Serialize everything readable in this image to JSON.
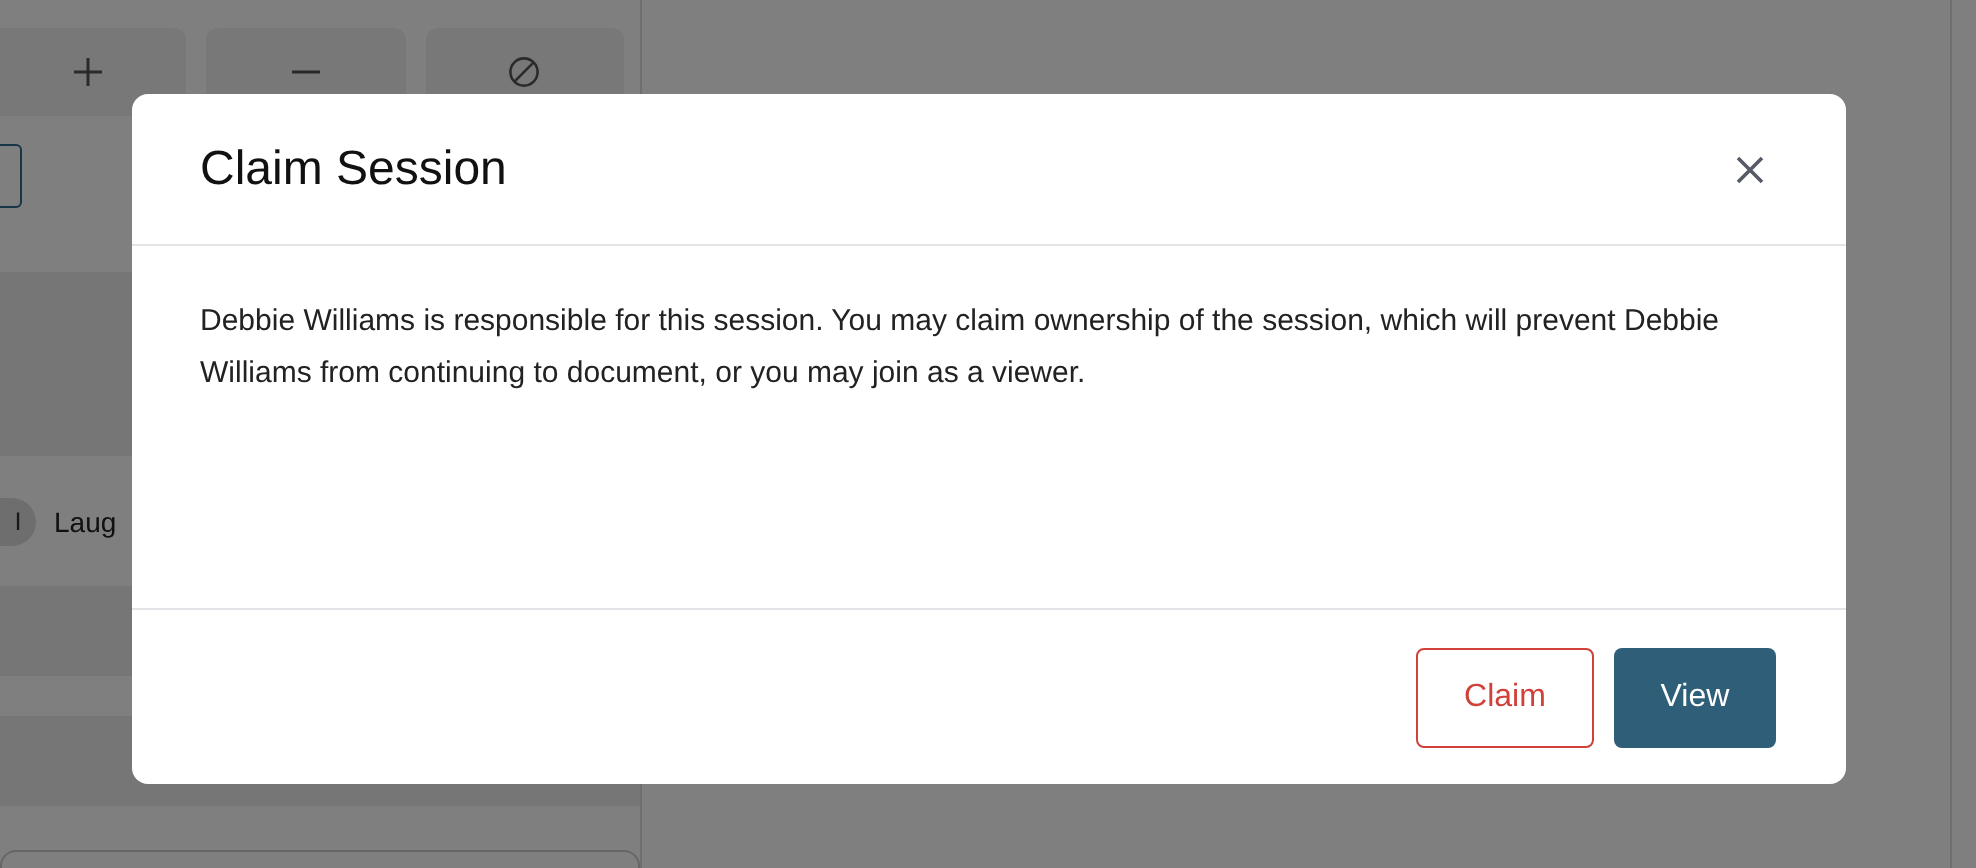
{
  "background": {
    "participant": {
      "initial": "I",
      "name": "Laug"
    }
  },
  "dialog": {
    "title": "Claim Session",
    "message": "Debbie Williams is responsible for this session. You may claim ownership of the session, which will prevent Debbie Williams from continuing to document, or you may join as a viewer.",
    "buttons": [
      {
        "label": "Claim",
        "kind": "outline"
      },
      {
        "label": "View",
        "kind": "primary"
      }
    ]
  }
}
